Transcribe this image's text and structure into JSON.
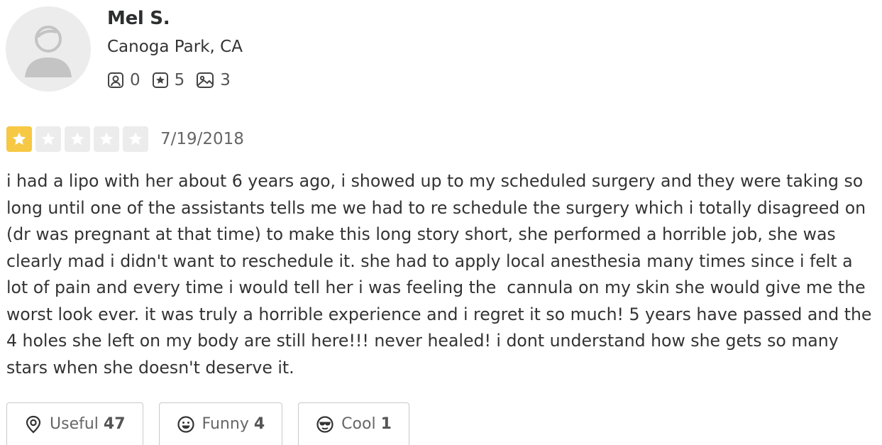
{
  "user": {
    "name": "Mel S.",
    "location": "Canoga Park, CA",
    "stats": {
      "friends": "0",
      "reviews": "5",
      "photos": "3"
    },
    "avatar_icon": "default-user-avatar"
  },
  "review": {
    "rating": 1,
    "max_rating": 5,
    "date": "7/19/2018",
    "text": "i had a lipo with her about 6 years ago, i showed up to my scheduled surgery and they were taking so long until one of the assistants tells me we had to re schedule the surgery which i totally disagreed on (dr was pregnant at that time) to make this long story short, she performed a horrible job, she was clearly mad i didn't want to reschedule it. she had to apply local anesthesia many times since i felt a lot of pain and every time i would tell her i was feeling the  cannula on my skin she would give me the worst look ever. it was truly a horrible experience and i regret it so much! 5 years have passed and the 4 holes she left on my body are still here!!! never healed! i dont understand how she gets so many stars when she doesn't deserve it."
  },
  "reactions": [
    {
      "label": "Useful",
      "count": "47",
      "icon": "lightbulb-icon"
    },
    {
      "label": "Funny",
      "count": "4",
      "icon": "smile-icon"
    },
    {
      "label": "Cool",
      "count": "1",
      "icon": "sunglasses-icon"
    }
  ],
  "colors": {
    "star_filled": "#f7c844",
    "star_empty": "#ececec",
    "text": "#333333"
  }
}
